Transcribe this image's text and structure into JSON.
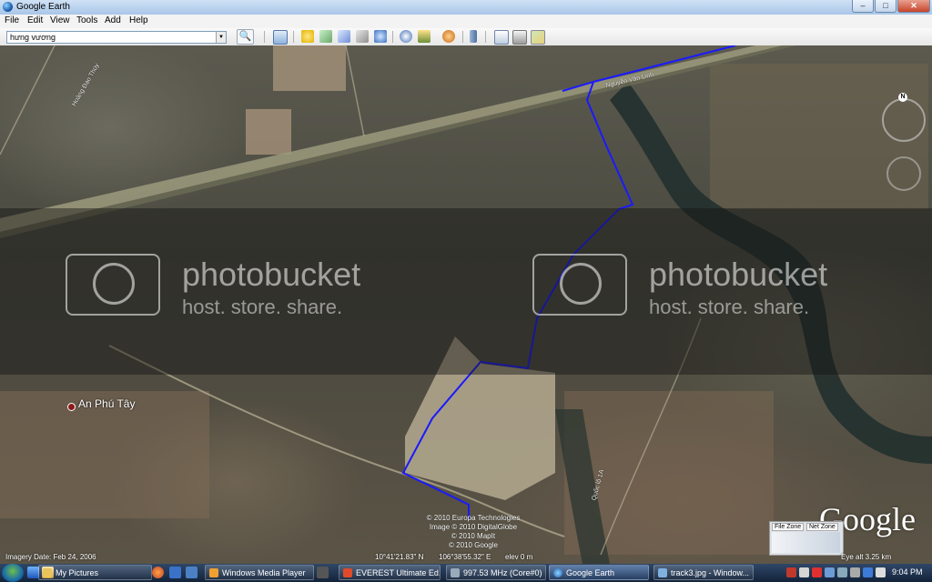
{
  "window": {
    "title": "Google Earth",
    "controls": [
      "–",
      "□",
      "✕"
    ]
  },
  "menu": [
    "File",
    "Edit",
    "View",
    "Tools",
    "Add",
    "Help"
  ],
  "toolbar": {
    "search_value": "hưng vương",
    "buttons": [
      "hide-sidebar-icon",
      "placemark-icon",
      "polygon-icon",
      "path-icon",
      "image-overlay-icon",
      "record-tour-icon",
      "historical-imagery-icon",
      "sunlight-icon",
      "planet-icon",
      "ruler-icon",
      "email-icon",
      "print-icon",
      "view-in-maps-icon"
    ]
  },
  "map": {
    "place_label": "An Phú Tây",
    "road_labels": [
      "Hoàng Đạo Thúy",
      "Nguyễn Văn Linh",
      "Quốc lộ 1A"
    ],
    "watermark": {
      "brand": "photobucket",
      "tagline": "host. store. share."
    },
    "credits": [
      "© 2010 Europa Technologies",
      "Image © 2010 DigitalGlobe",
      "© 2010 MapIt",
      "© 2010 Google"
    ],
    "logo": "Google",
    "legend_tabs": [
      "File Zone",
      "Net Zone"
    ],
    "status": {
      "imagery_date": "Imagery Date: Feb 24, 2006",
      "lat": "10°41'21.83\" N",
      "lon": "106°38'55.32\" E",
      "elev": "elev 0 m",
      "eye_alt": "Eye alt  3.25 km"
    },
    "track_color": "#1a1aff"
  },
  "taskbar": {
    "tasks": [
      {
        "label": "My Pictures",
        "icon": "folder-icon",
        "active": false
      },
      {
        "label": "Windows Media Player",
        "icon": "media-player-icon",
        "active": false
      },
      {
        "label": "EVEREST Ultimate Ed...",
        "icon": "everest-icon",
        "active": false
      },
      {
        "label": "997.53 MHz (Core#0)",
        "icon": "cpu-icon",
        "active": false
      },
      {
        "label": "Google Earth",
        "icon": "google-earth-icon",
        "active": true
      },
      {
        "label": "track3.jpg - Window...",
        "icon": "photo-viewer-icon",
        "active": false
      }
    ],
    "clock": "9:04 PM"
  }
}
